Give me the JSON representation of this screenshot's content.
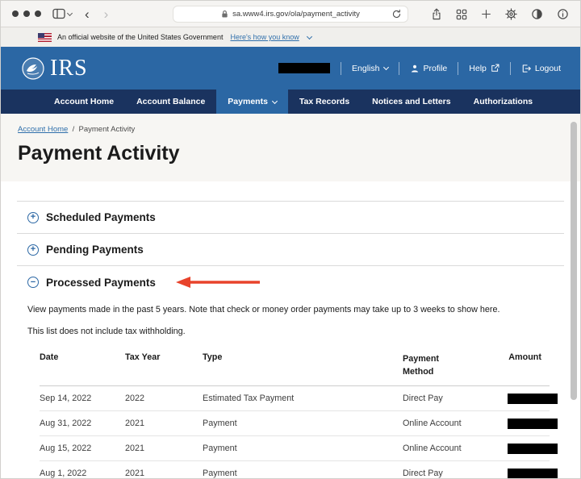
{
  "browser": {
    "url": "sa.www4.irs.gov/ola/payment_activity"
  },
  "gov_banner": {
    "text": "An official website of the United States Government",
    "link_label": "Here's how you know"
  },
  "header": {
    "logo_text": "IRS",
    "language_label": "English",
    "profile_label": "Profile",
    "help_label": "Help",
    "logout_label": "Logout"
  },
  "nav": {
    "active_item": "Payments",
    "items": [
      {
        "label": "Account Home"
      },
      {
        "label": "Account Balance"
      },
      {
        "label": "Payments"
      },
      {
        "label": "Tax Records"
      },
      {
        "label": "Notices and Letters"
      },
      {
        "label": "Authorizations"
      }
    ]
  },
  "breadcrumb": {
    "link_label": "Account Home",
    "separator": "/",
    "current": "Payment Activity"
  },
  "page": {
    "title": "Payment Activity"
  },
  "sections": [
    {
      "label": "Scheduled Payments",
      "state": "collapsed",
      "icon": "+"
    },
    {
      "label": "Pending Payments",
      "state": "collapsed",
      "icon": "+"
    },
    {
      "label": "Processed Payments",
      "state": "expanded",
      "icon": "−"
    }
  ],
  "annotation": {
    "type": "red-arrow-pointing-left",
    "target": "Processed Payments",
    "color": "#e8432b"
  },
  "processed": {
    "description": "View payments made in the past 5 years. Note that check or money order payments may take up to 3 weeks to show here.",
    "note": "This list does not include tax withholding.",
    "table": {
      "columns": [
        "Date",
        "Tax Year",
        "Type",
        "Payment Method",
        "Amount"
      ],
      "rows": [
        {
          "date": "Sep 14, 2022",
          "tax_year": "2022",
          "type": "Estimated Tax Payment",
          "payment_method": "Direct Pay",
          "amount_redacted": true
        },
        {
          "date": "Aug 31, 2022",
          "tax_year": "2021",
          "type": "Payment",
          "payment_method": "Online Account",
          "amount_redacted": true
        },
        {
          "date": "Aug 15, 2022",
          "tax_year": "2021",
          "type": "Payment",
          "payment_method": "Online Account",
          "amount_redacted": true
        },
        {
          "date": "Aug 1, 2022",
          "tax_year": "2021",
          "type": "Payment",
          "payment_method": "Direct Pay",
          "amount_redacted": true
        }
      ]
    }
  },
  "colors": {
    "header_blue": "#2b67a4",
    "nav_navy": "#1a335f",
    "link_blue": "#2f6fab",
    "arrow_red": "#e8432b",
    "redaction_black": "#000000"
  }
}
